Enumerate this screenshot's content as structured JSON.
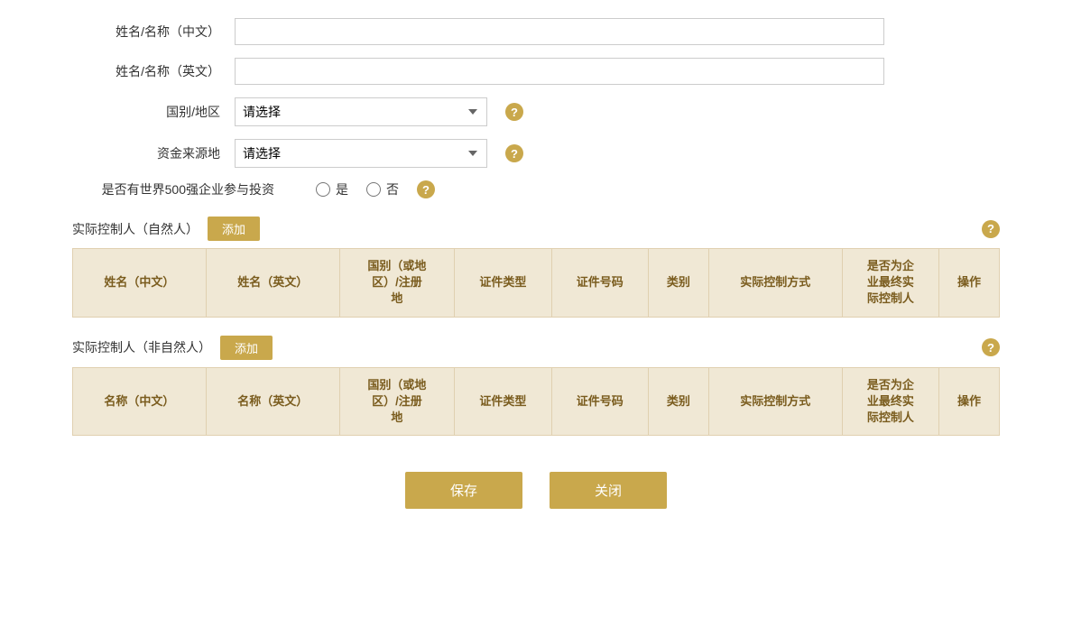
{
  "form": {
    "name_zh_label": "姓名/名称（中文）",
    "name_en_label": "姓名/名称（英文）",
    "country_label": "国别/地区",
    "fund_source_label": "资金来源地",
    "fortune500_label": "是否有世界500强企业参与投资",
    "country_placeholder": "请选择",
    "fund_source_placeholder": "请选择",
    "radio_yes": "是",
    "radio_no": "否",
    "name_zh_value": "",
    "name_en_value": ""
  },
  "natural_person_section": {
    "title": "实际控制人（自然人）",
    "add_label": "添加",
    "help": "?",
    "columns": [
      "姓名（中文）",
      "姓名（英文）",
      "国别（或地区）/注册地",
      "证件类型",
      "证件号码",
      "类别",
      "实际控制方式",
      "是否为企业最终实际控制人",
      "操作"
    ]
  },
  "non_natural_person_section": {
    "title": "实际控制人（非自然人）",
    "add_label": "添加",
    "help": "?",
    "columns": [
      "名称（中文）",
      "名称（英文）",
      "国别（或地区）/注册地",
      "证件类型",
      "证件号码",
      "类别",
      "实际控制方式",
      "是否为企业最终实际控制人",
      "操作"
    ]
  },
  "buttons": {
    "save": "保存",
    "close": "关闭"
  },
  "help_icon": "?"
}
